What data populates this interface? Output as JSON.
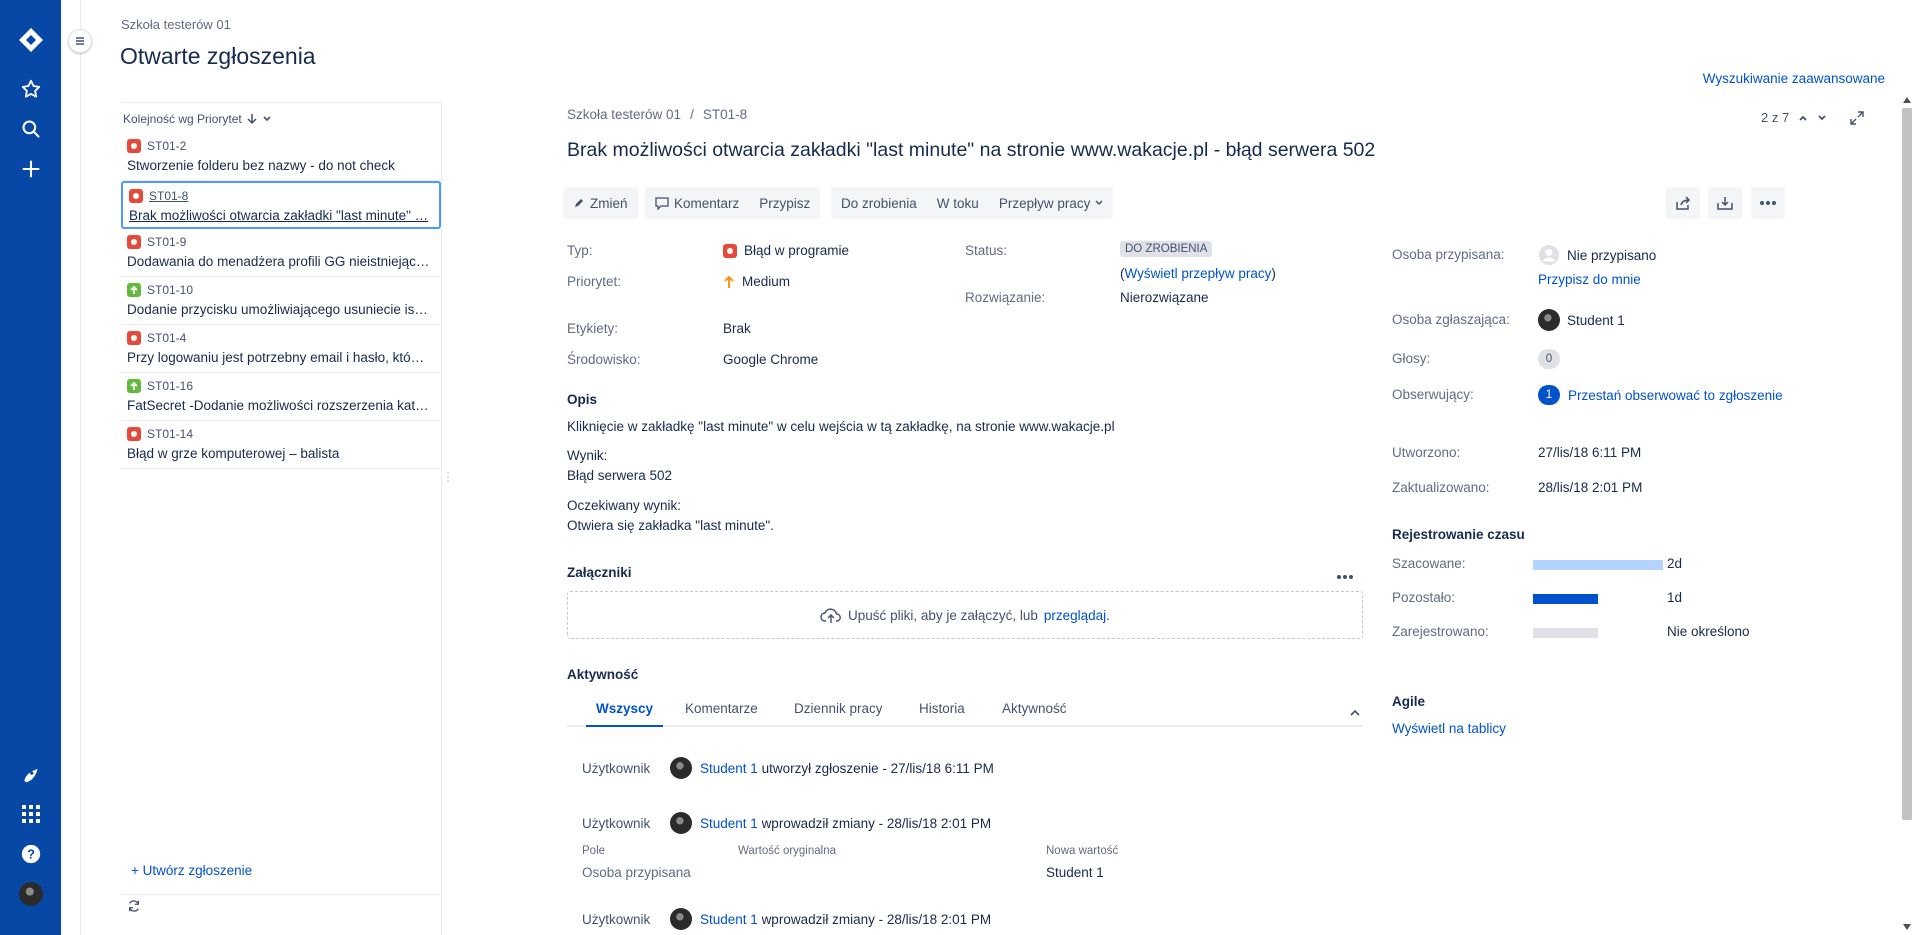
{
  "breadcrumb_top": "Szkoła testerów 01",
  "page_title": "Otwarte zgłoszenia",
  "advanced_search": "Wyszukiwanie zaawansowane",
  "list": {
    "order_label": "Kolejność wg Priorytet",
    "items": [
      {
        "key": "ST01-2",
        "summary": "Stworzenie folderu bez nazwy - do not check",
        "type": "bug"
      },
      {
        "key": "ST01-8",
        "summary": "Brak możliwości otwarcia zakładki \"last minute\" …",
        "type": "bug",
        "selected": true
      },
      {
        "key": "ST01-9",
        "summary": "Dodawania do menadżera profili GG nieistniejąc…",
        "type": "bug"
      },
      {
        "key": "ST01-10",
        "summary": "Dodanie przycisku umożliwiającego usuniecie is…",
        "type": "improvement"
      },
      {
        "key": "ST01-4",
        "summary": "Przy logowaniu jest potrzebny email i hasło, któ…",
        "type": "bug"
      },
      {
        "key": "ST01-16",
        "summary": "FatSecret -Dodanie możliwości rozszerzenia kat…",
        "type": "improvement"
      },
      {
        "key": "ST01-14",
        "summary": "Błąd w grze komputerowej – balista",
        "type": "bug"
      }
    ],
    "create_link": "+ Utwórz zgłoszenie"
  },
  "issue": {
    "breadcrumb_project": "Szkoła testerów 01",
    "breadcrumb_sep": "/",
    "breadcrumb_key": "ST01-8",
    "pager": "2 z 7",
    "title": "Brak możliwości otwarcia zakładki \"last minute\" na stronie www.wakacje.pl - błąd serwera 502",
    "toolbar": {
      "edit": "Zmień",
      "comment": "Komentarz",
      "assign": "Przypisz",
      "todo": "Do zrobienia",
      "inprogress": "W toku",
      "workflow": "Przepływ pracy"
    },
    "details": {
      "type_label": "Typ:",
      "type_value": "Błąd w programie",
      "priority_label": "Priorytet:",
      "priority_value": "Medium",
      "labels_label": "Etykiety:",
      "labels_value": "Brak",
      "env_label": "Środowisko:",
      "env_value": "Google Chrome",
      "status_label": "Status:",
      "status_value": "DO ZROBIENIA",
      "view_workflow": "Wyświetl przepływ pracy",
      "resolution_label": "Rozwiązanie:",
      "resolution_value": "Nierozwiązane"
    },
    "description": {
      "heading": "Opis",
      "line1": "Kliknięcie w zakładkę \"last minute\" w celu wejścia w tą zakładkę, na stronie www.wakacje.pl",
      "result_label": "Wynik:",
      "result_value": "Błąd serwera 502",
      "expected_label": "Oczekiwany wynik:",
      "expected_value": "Otwiera się zakładka \"last minute\"."
    },
    "attachments": {
      "heading": "Załączniki",
      "drop_text": "Upuść pliki, aby je załączyć, lub",
      "browse": "przeglądaj."
    },
    "activity": {
      "heading": "Aktywność",
      "tabs": [
        "Wszyscy",
        "Komentarze",
        "Dziennik pracy",
        "Historia",
        "Aktywność"
      ],
      "entries": [
        {
          "who": "Użytkownik",
          "user": "Student 1",
          "text": "utworzył zgłoszenie - 27/lis/18 6:11 PM"
        },
        {
          "who": "Użytkownik",
          "user": "Student 1",
          "text": "wprowadził zmiany - 28/lis/18 2:01 PM"
        },
        {
          "who": "Użytkownik",
          "user": "Student 1",
          "text": "wprowadził zmiany - 28/lis/18 2:01 PM"
        }
      ],
      "change_table": {
        "col_field": "Pole",
        "col_original": "Wartość oryginalna",
        "col_new": "Nowa wartość",
        "field": "Osoba przypisana",
        "original": "",
        "new": "Student 1"
      }
    }
  },
  "people": {
    "assignee_label": "Osoba przypisana:",
    "assignee_value": "Nie przypisano",
    "assign_to_me": "Przypisz do mnie",
    "reporter_label": "Osoba zgłaszająca:",
    "reporter_value": "Student 1",
    "votes_label": "Głosy:",
    "votes_value": "0",
    "watchers_label": "Obserwujący:",
    "watchers_value": "1",
    "stop_watching": "Przestań obserwować to zgłoszenie"
  },
  "dates": {
    "created_label": "Utworzono:",
    "created_value": "27/lis/18 6:11 PM",
    "updated_label": "Zaktualizowano:",
    "updated_value": "28/lis/18 2:01 PM"
  },
  "time_tracking": {
    "heading": "Rejestrowanie czasu",
    "estimated_label": "Szacowane:",
    "estimated_value": "2d",
    "remaining_label": "Pozostało:",
    "remaining_value": "1d",
    "logged_label": "Zarejestrowano:",
    "logged_value": "Nie określono",
    "estimated_fraction": 1.0,
    "remaining_fraction": 0.5,
    "logged_fraction": 0
  },
  "agile": {
    "heading": "Agile",
    "view_on_board": "Wyświetl na tablicy"
  },
  "colors": {
    "nav": "#0747a6",
    "link": "#0052cc",
    "bug": "#e5493a",
    "improvement": "#63ba3c",
    "estimate_bar": "#b3d4ff",
    "remaining_bar": "#0052cc",
    "logged_bar": "#dfe1e6"
  }
}
